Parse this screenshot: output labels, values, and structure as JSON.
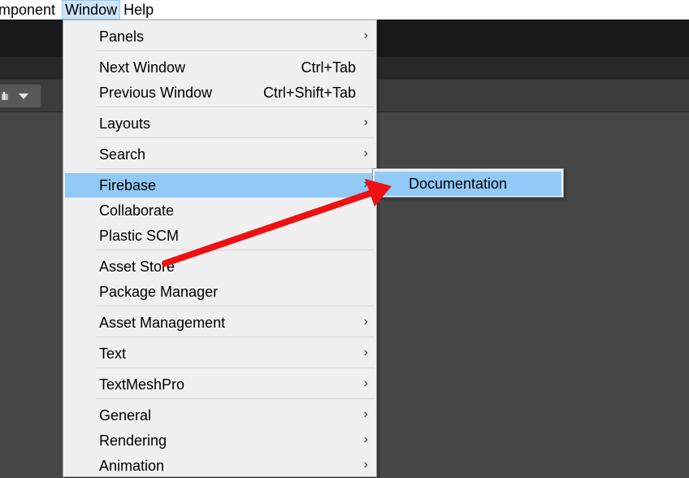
{
  "menubar": {
    "items": [
      {
        "label": "mponent"
      },
      {
        "label": "Window"
      },
      {
        "label": "Help"
      }
    ]
  },
  "window_menu": {
    "items": [
      {
        "label": "Panels",
        "shortcut": "",
        "submenu_icon": "chevron-right-icon"
      },
      {
        "label": "Next Window",
        "shortcut": "Ctrl+Tab"
      },
      {
        "label": "Previous Window",
        "shortcut": "Ctrl+Shift+Tab"
      },
      {
        "label": "Layouts",
        "submenu_icon": "chevron-right-icon"
      },
      {
        "label": "Search",
        "submenu_icon": "chevron-right-icon"
      },
      {
        "label": "Firebase",
        "submenu_icon": "chevron-right-icon",
        "highlighted": true
      },
      {
        "label": "Collaborate"
      },
      {
        "label": "Plastic SCM"
      },
      {
        "label": "Asset Store"
      },
      {
        "label": "Package Manager"
      },
      {
        "label": "Asset Management",
        "submenu_icon": "chevron-right-icon"
      },
      {
        "label": "Text",
        "submenu_icon": "chevron-right-icon"
      },
      {
        "label": "TextMeshPro",
        "submenu_icon": "chevron-right-icon"
      },
      {
        "label": "General",
        "submenu_icon": "chevron-right-icon"
      },
      {
        "label": "Rendering",
        "submenu_icon": "chevron-right-icon"
      },
      {
        "label": "Animation",
        "submenu_icon": "chevron-right-icon"
      }
    ]
  },
  "firebase_submenu": {
    "items": [
      {
        "label": "Documentation",
        "highlighted": true
      }
    ]
  },
  "arrow_glyph": "›",
  "colors": {
    "highlight": "#91c9f7",
    "annotation_arrow": "#ee1111",
    "menu_bg": "#f0f0f0",
    "editor_bg": "#464646"
  }
}
